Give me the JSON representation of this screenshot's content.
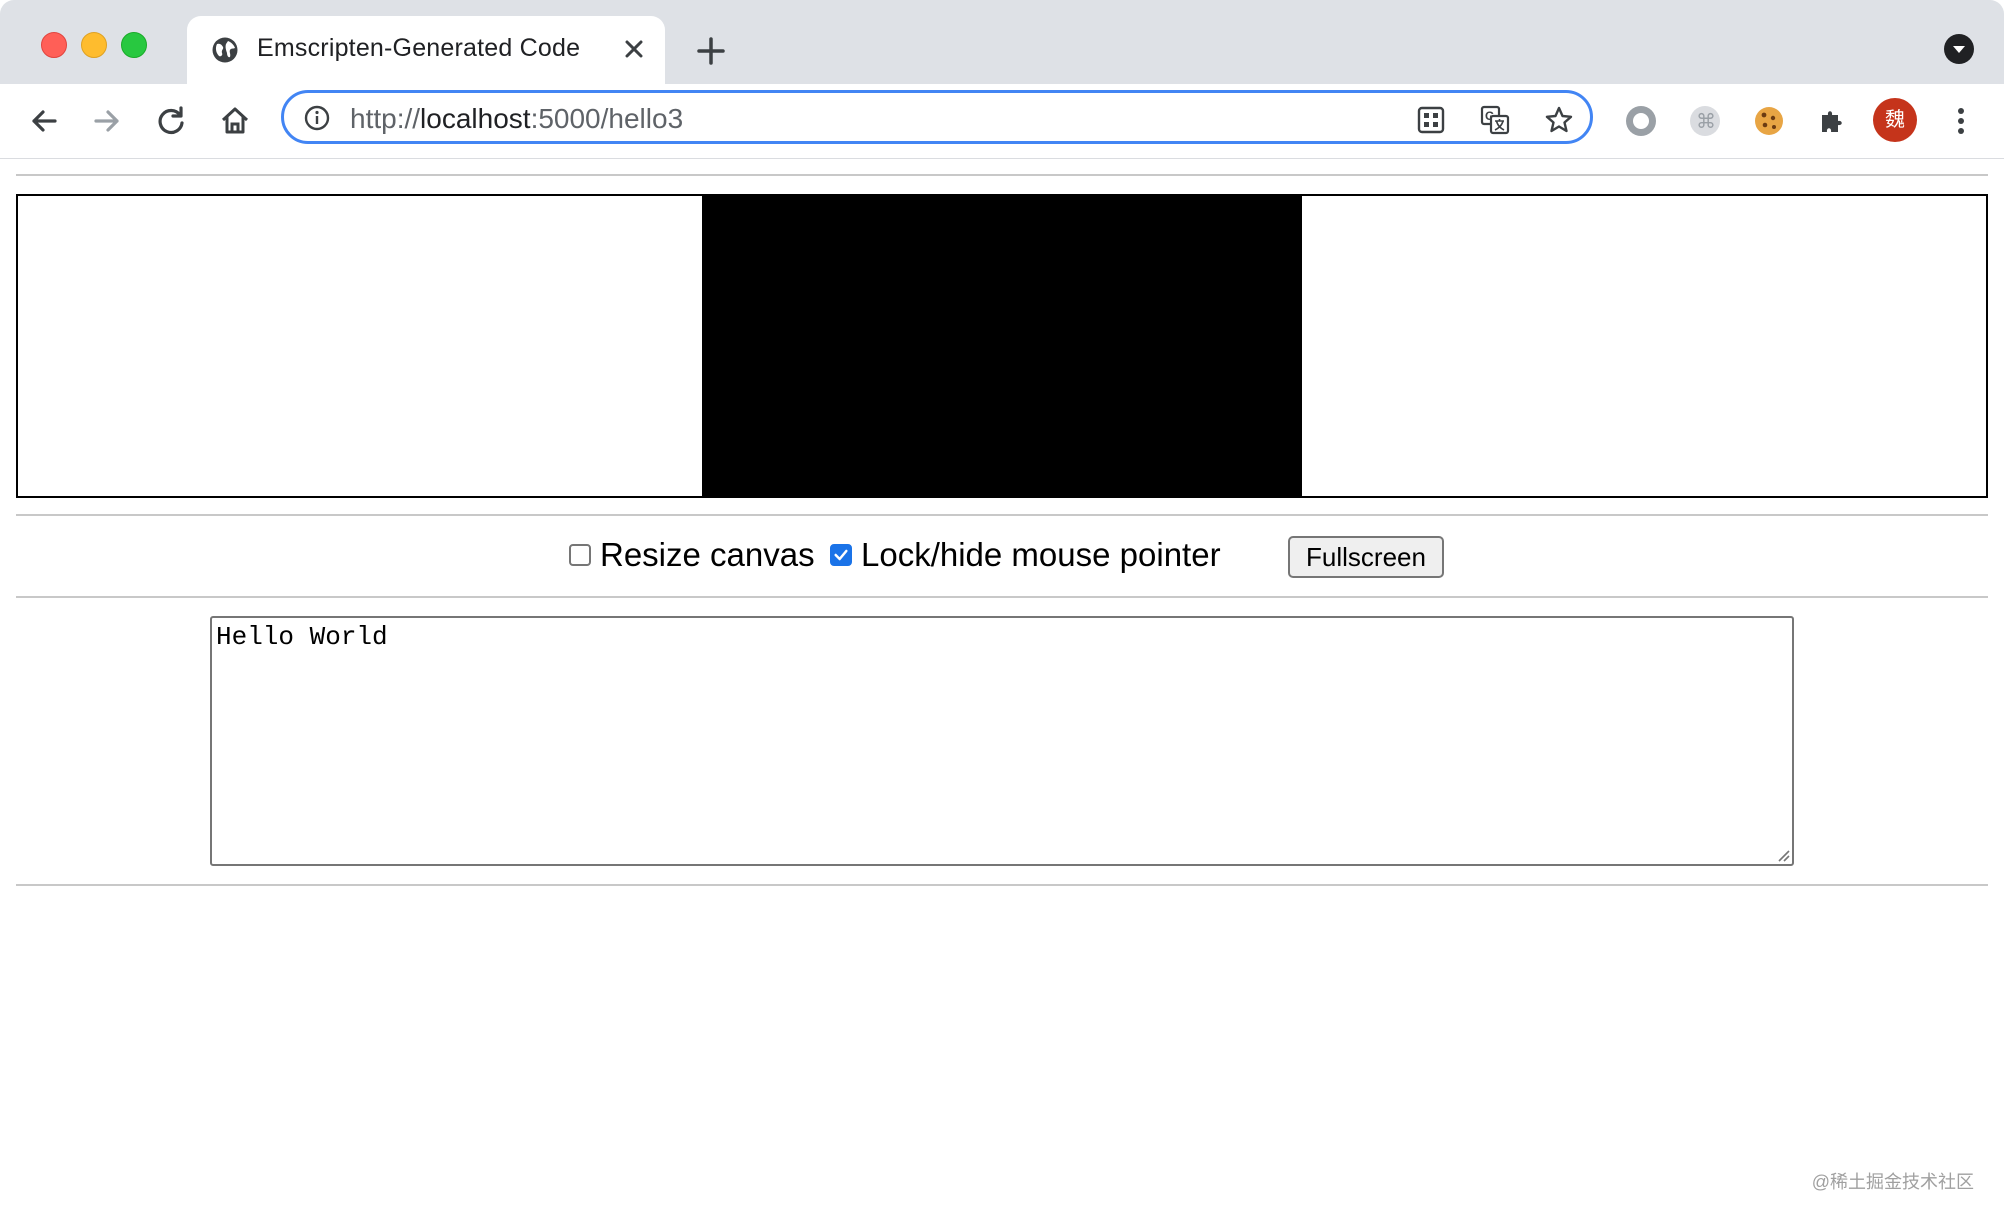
{
  "browser": {
    "tab_title": "Emscripten-Generated Code",
    "url_scheme": "http://",
    "url_host": "localhost",
    "url_rest": ":5000/hello3",
    "avatar_text": "魏",
    "icons": {
      "back": "arrow-left-icon",
      "forward": "arrow-right-icon",
      "reload": "reload-icon",
      "home": "home-icon",
      "info": "info-icon",
      "qr": "qr-code-icon",
      "translate": "translate-icon",
      "bookmark": "star-icon",
      "ext1": "record-extension-icon",
      "ext2": "command-extension-icon",
      "ext3": "cookie-extension-icon",
      "extensions": "puzzle-icon",
      "menu": "kebab-menu-icon"
    }
  },
  "page": {
    "resize_canvas_label": "Resize canvas",
    "resize_canvas_checked": false,
    "lock_pointer_label": "Lock/hide mouse pointer",
    "lock_pointer_checked": true,
    "fullscreen_label": "Fullscreen",
    "output_text": "Hello World",
    "watermark": "@稀土掘金技术社区"
  },
  "colors": {
    "tabstrip": "#dee1e6",
    "omnibox_focus": "#4285f4",
    "checkbox_checked": "#1a73e8",
    "canvas": "#000000"
  }
}
